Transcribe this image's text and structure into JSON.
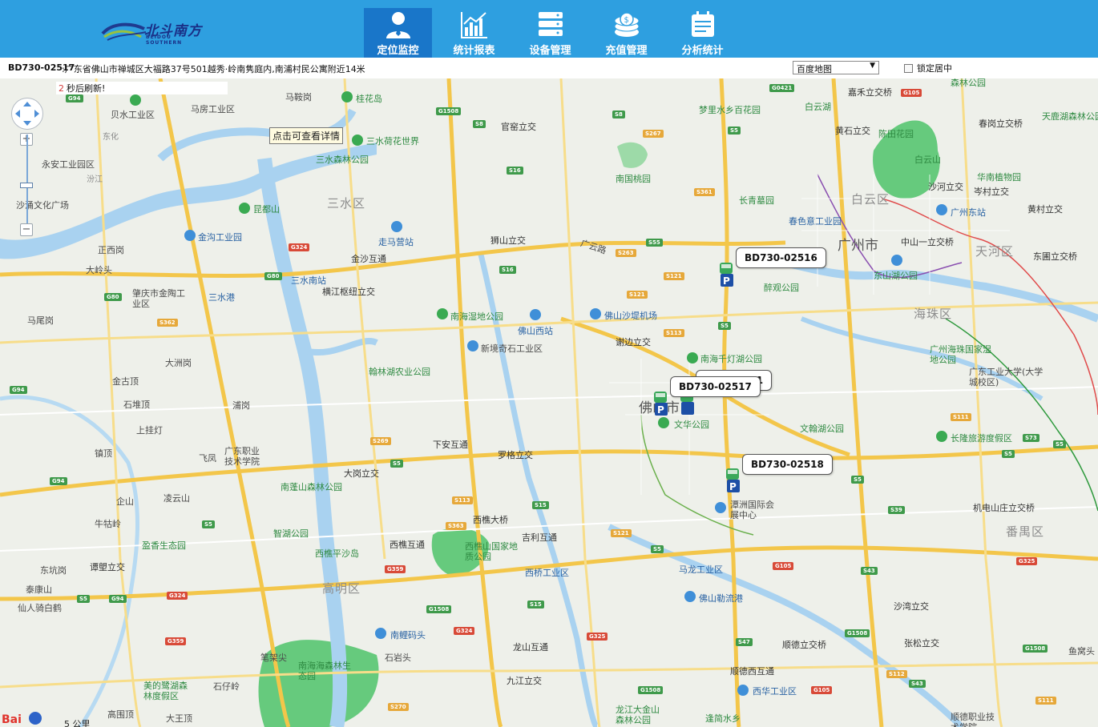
{
  "header": {
    "logo": {
      "name_cn": "北斗南方",
      "name_en": "BEIDOU SOUTHERN"
    },
    "nav": [
      {
        "label": "定位监控",
        "icon": "user-icon",
        "active": true
      },
      {
        "label": "统计报表",
        "icon": "bar-chart-icon",
        "active": false
      },
      {
        "label": "设备管理",
        "icon": "server-icon",
        "active": false
      },
      {
        "label": "充值管理",
        "icon": "coins-icon",
        "active": false
      },
      {
        "label": "分析统计",
        "icon": "calendar-icon",
        "active": false
      }
    ]
  },
  "status": {
    "device": "BD730-02517",
    "address": ":广东省佛山市禅城区大福路37号501越秀·岭南隽庭内,南浦村民公寓附近14米",
    "map_type": "百度地图",
    "lock_center_label": "锁定居中",
    "lock_center_checked": false
  },
  "map": {
    "refresh_count": "2",
    "refresh_text": "秒后刷新!",
    "tip": "点击可查看详情",
    "scale_text": "5 公里",
    "baidu_logo": "Bai地图",
    "vehicles": [
      {
        "id": "BD730-02516"
      },
      {
        "id": "BD730-02517"
      },
      {
        "id": "BD730-02518"
      },
      {
        "id": "571"
      }
    ],
    "districts": [
      "三水区",
      "白云区",
      "广州市",
      "天河区",
      "海珠区",
      "番禺区",
      "高明区",
      "佛山市"
    ],
    "places": [
      "马鞍岗",
      "桂花岛",
      "官窑立交",
      "梦里水乡百花园",
      "嘉禾立交桥",
      "森林公园",
      "贝水工业区",
      "马房工业区",
      "白云湖",
      "黄石立交",
      "陈田花园",
      "春岗立交桥",
      "天鹿湖森林公园",
      "东化",
      "三水荷花世界",
      "三水森林公园",
      "南国桃园",
      "白云山",
      "沙河立交",
      "岑村立交",
      "永安工业园区",
      "汾江",
      "华南植物园",
      "长青墓园",
      "春色意工业园",
      "广州东站",
      "黄村立交",
      "沙涌文化广场",
      "昆都山",
      "走马营站",
      "狮山立交",
      "中山一立交桥",
      "东圃立交桥",
      "正西岗",
      "金沟工业园",
      "广云路",
      "金沙互通",
      "东山湖公园",
      "大岭头",
      "三水南站",
      "醉观公园",
      "肇庆市金陶工业区",
      "三水港",
      "横江枢纽立交",
      "南海湿地公园",
      "佛山沙堤机场",
      "佛山西站",
      "马尾岗",
      "新境奇石工业区",
      "谢边立交",
      "南海千灯湖公园",
      "广州海珠国家湿地公园",
      "大洲岗",
      "广东工业大学(大学城校区)",
      "金古顶",
      "翰林湖农业公园",
      "石堆顶",
      "上挂灯",
      "浦岗",
      "文华公园",
      "文翰湖公园",
      "镇顶",
      "广东职业技术学院",
      "飞凤",
      "下安互通",
      "罗格立交",
      "长隆旅游度假区",
      "大岗立交",
      "南蓬山森林公园",
      "企山",
      "凌云山",
      "潭洲国际会展中心",
      "机电山庄立交桥",
      "牛牯岭",
      "西樵大桥",
      "吉利互通",
      "智湖公园",
      "盈香生态园",
      "西樵互通",
      "西樵山国家地质公园",
      "东坑岗",
      "谭塱立交",
      "西樵平沙岛",
      "西桥工业区",
      "马龙工业区",
      "泰康山",
      "佛山勒流港",
      "沙湾立交",
      "仙人骑白鹤",
      "南鲤码头",
      "顺德立交桥",
      "张松立交",
      "鱼窝头",
      "笔架尖",
      "石岩头",
      "龙山互通",
      "南海海森林生态园",
      "顺德西互通",
      "美的鹭湖森林度假区",
      "石仔岭",
      "九江立交",
      "西华工业区",
      "高围顶",
      "大王顶",
      "逢简水乡",
      "龙江大金山森林公园",
      "顺德职业技术学院"
    ]
  }
}
